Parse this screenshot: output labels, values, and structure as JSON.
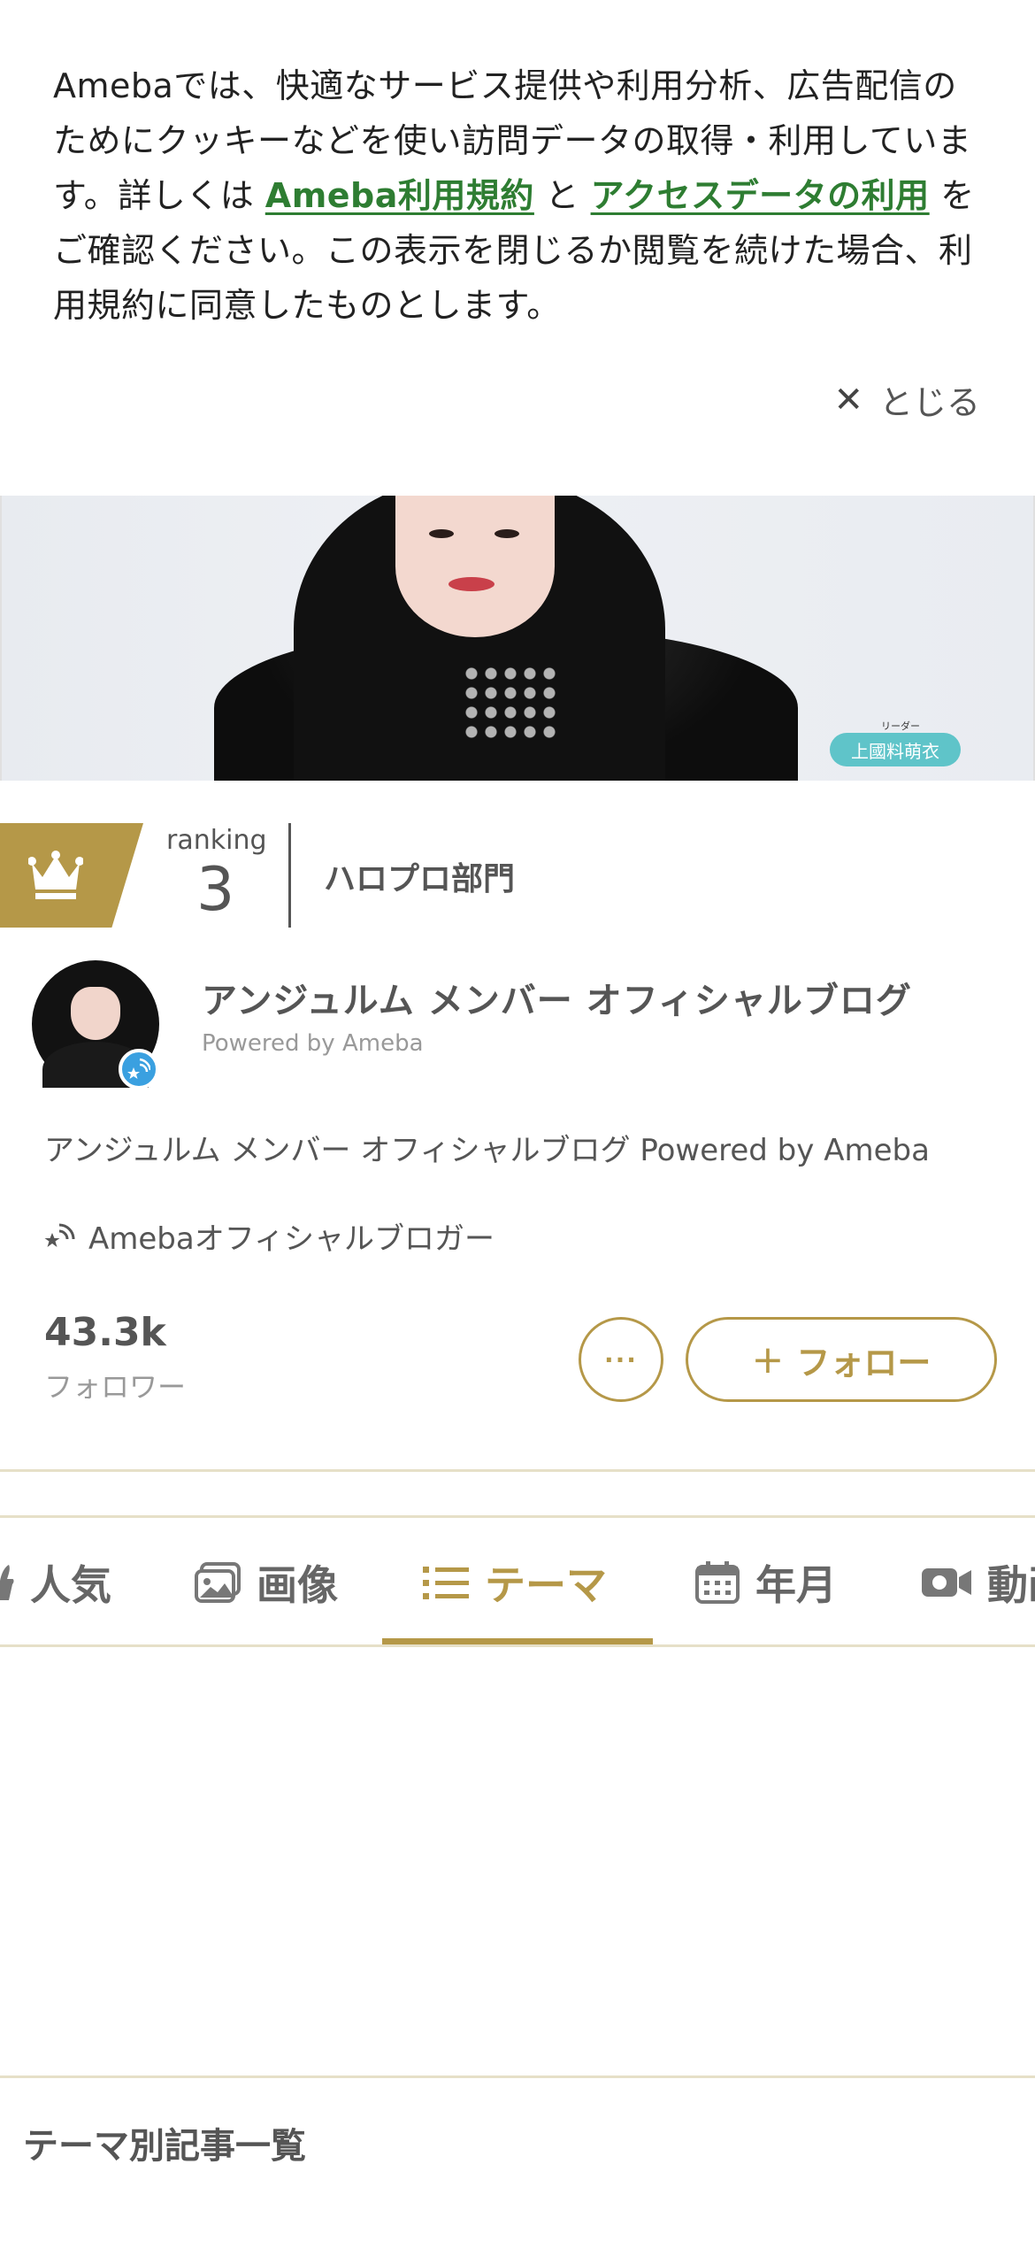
{
  "cookie_banner": {
    "text_before": "Amebaでは、快適なサービス提供や利用分析、広告配信のためにクッキーなどを使い訪問データの取得・利用しています。詳しくは ",
    "link1": "Ameba利用規約",
    "text_mid": " と ",
    "link2": "アクセスデータの利用",
    "text_after": " をご確認ください。この表示を閉じるか閲覧を続けた場合、利用規約に同意したものとします。",
    "close_label": "とじる"
  },
  "header_image": {
    "name_ruby": "リーダー",
    "name_tag": "上國料萌衣"
  },
  "ranking": {
    "label": "ranking",
    "rank": "3",
    "category": "ハロプロ部門"
  },
  "blog": {
    "title": "アンジュルム メンバー オフィシャルブログ",
    "powered_by": "Powered by Ameba",
    "description": "アンジュルム メンバー オフィシャルブログ Powered by Ameba",
    "official_label": "Amebaオフィシャルブロガー"
  },
  "followers": {
    "count": "43.3k",
    "label": "フォロワー"
  },
  "actions": {
    "more_label": "···",
    "follow_plus": "+",
    "follow_label": "フォロー"
  },
  "tabs": [
    {
      "label": "人気",
      "icon": "popular-icon"
    },
    {
      "label": "画像",
      "icon": "image-icon"
    },
    {
      "label": "テーマ",
      "icon": "list-icon",
      "active": true
    },
    {
      "label": "年月",
      "icon": "calendar-icon"
    },
    {
      "label": "動画",
      "icon": "video-icon"
    }
  ],
  "section": {
    "title": "テーマ別記事一覧"
  },
  "colors": {
    "accent": "#b59848",
    "link": "#2e7d32",
    "badge": "#3aa0e0"
  }
}
